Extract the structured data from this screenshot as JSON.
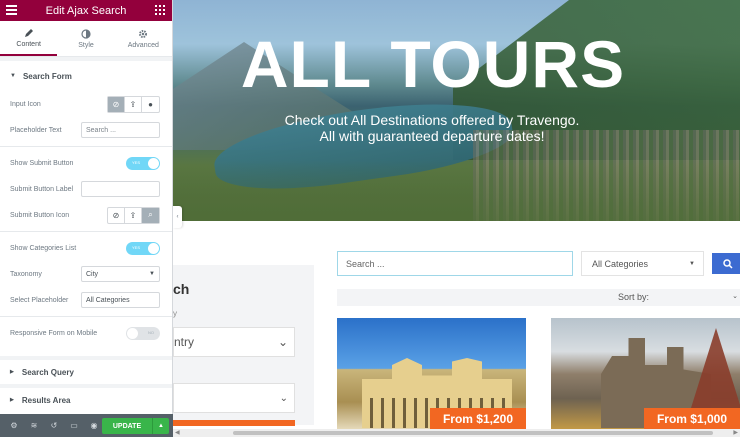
{
  "header": {
    "title": "Edit Ajax Search"
  },
  "tabs": [
    {
      "label": "Content",
      "icon": "pencil-icon",
      "active": true
    },
    {
      "label": "Style",
      "icon": "half-circle-icon",
      "active": false
    },
    {
      "label": "Advanced",
      "icon": "gear-icon",
      "active": false
    }
  ],
  "search_form": {
    "title": "Search Form",
    "input_icon_label": "Input Icon",
    "placeholder_text_label": "Placeholder Text",
    "placeholder_text_value": "Search ...",
    "show_submit_label": "Show Submit Button",
    "show_submit_toggle": "YES",
    "submit_label_label": "Submit Button Label",
    "submit_label_value": "",
    "submit_icon_label": "Submit Button Icon",
    "show_categories_label": "Show Categories List",
    "show_categories_toggle": "YES",
    "taxonomy_label": "Taxonomy",
    "taxonomy_value": "City",
    "select_placeholder_label": "Select Placeholder",
    "select_placeholder_value": "All Categories",
    "responsive_label": "Responsive Form on Mobile",
    "responsive_toggle": "NO"
  },
  "collapsed_sections": [
    "Search Query",
    "Results Area"
  ],
  "footer": {
    "update_label": "UPDATE"
  },
  "preview": {
    "hero_title": "ALL TOURS",
    "hero_line1": "Check out All Destinations offered by Travengo.",
    "hero_line2": "All with guaranteed departure dates!",
    "side_title": "ch",
    "side_sub": "y",
    "side_dropdown": "ntry",
    "search_placeholder": "Search ...",
    "category_select": "All Categories",
    "sort_label": "Sort by:",
    "cards": [
      {
        "price": "From $1,200"
      },
      {
        "price": "From $1,000"
      }
    ]
  },
  "colors": {
    "header_bg": "#93003c",
    "toggle_on": "#71d7f7",
    "update_green": "#39b54a",
    "price_orange": "#f26722",
    "search_blue": "#3c6bd1"
  }
}
